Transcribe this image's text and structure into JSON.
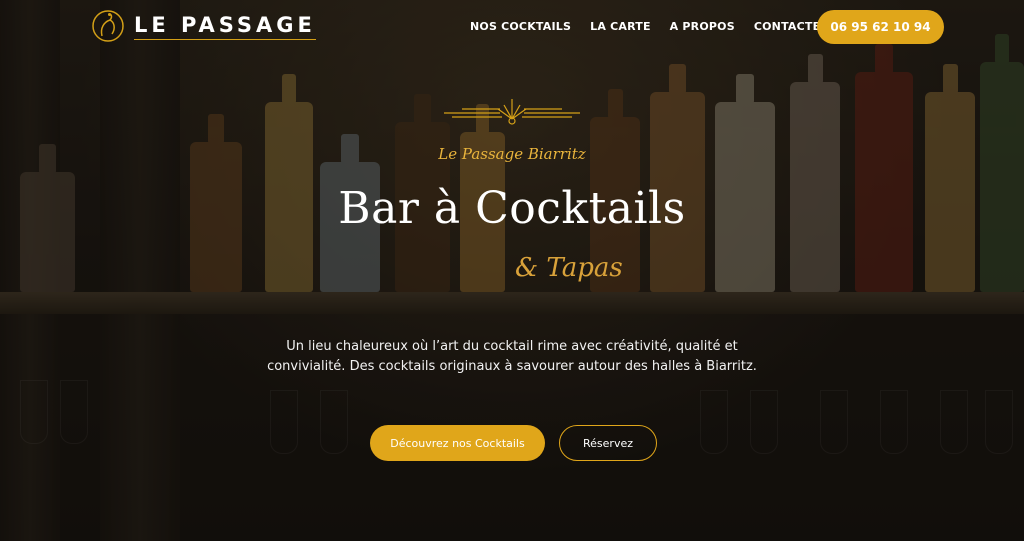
{
  "brand": {
    "name": "LE PASSAGE",
    "logo_icon": "heron-circle-logo"
  },
  "nav": {
    "items": [
      {
        "label": "NOS COCKTAILS"
      },
      {
        "label": "LA CARTE"
      },
      {
        "label": "A PROPOS"
      },
      {
        "label": "CONTACTEZ-NOUS"
      }
    ],
    "phone": "06 95 62 10 94"
  },
  "hero": {
    "ornament_icon": "art-deco-ornament-icon",
    "subtitle": "Le Passage Biarritz",
    "title": "Bar à Cocktails",
    "tagline": "& Tapas",
    "description": "Un lieu chaleureux où l’art du cocktail rime avec créativité, qualité et convivialité. Des cocktails originaux à savourer autour des halles à Biarritz.",
    "primary_button": "Découvrez nos Cocktails",
    "secondary_button": "Réservez"
  },
  "colors": {
    "accent": "#e0a61a",
    "gold_text": "#e9b43c",
    "overlay": "#0a0806"
  }
}
